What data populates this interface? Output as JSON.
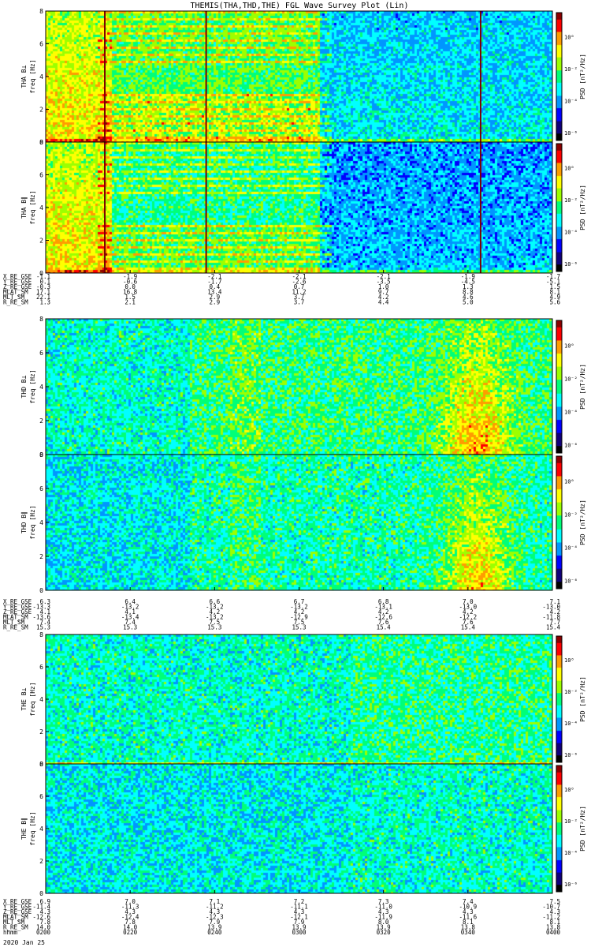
{
  "title": "THEMIS(THA,THD,THE) FGL Wave Survey Plot (Lin)",
  "date_label": "2020 Jan 25",
  "colorbar_label": "PSD [nT²/Hz]",
  "colorbar_ticks": [
    "10⁰",
    "10⁻²",
    "10⁻⁴",
    "10⁻⁶"
  ],
  "colormap": [
    "#000000",
    "#10007a",
    "#0000ff",
    "#0096ff",
    "#00ffff",
    "#00ff78",
    "#9cff00",
    "#ffff00",
    "#ff9c00",
    "#ff0000",
    "#8c0000"
  ],
  "chart_data": [
    {
      "type": "heatmap",
      "probe": "THA",
      "x_axis_type": "time",
      "x_tick_times": [
        "0200",
        "0220",
        "0240",
        "0300",
        "0320",
        "0340",
        "0400"
      ],
      "panels": [
        {
          "ylabel": "THA B⊥",
          "yunit": "freq [Hz]",
          "ylim": [
            0,
            8
          ],
          "yticks": [
            "0",
            "2",
            "4",
            "6",
            "8"
          ],
          "clim_log10": [
            -6.5,
            1.5
          ]
        },
        {
          "ylabel": "THA B∥",
          "yunit": "freq [Hz]",
          "ylim": [
            0,
            8
          ],
          "yticks": [
            "0",
            "2",
            "4",
            "6",
            "8"
          ],
          "clim_log10": [
            -6.5,
            1.5
          ]
        }
      ],
      "data_gaps_at": [
        "0214",
        "0238",
        "0343"
      ],
      "orbit_rows": [
        {
          "label": "X_RE_GSE",
          "values": [
            "-1.1",
            "-1.9",
            "-2.1",
            "-2.1",
            "-2.1",
            "-1.9",
            "-1.7"
          ]
        },
        {
          "label": "Y_RE_GSE",
          "values": [
            "0.1",
            "-0.6",
            "-1.7",
            "-2.6",
            "-3.5",
            "-4.5",
            "-5.1"
          ]
        },
        {
          "label": "Z_RE_GSE",
          "values": [
            "-0.3",
            "0.0",
            "0.4",
            "0.7",
            "1.0",
            "1.3",
            "1.5"
          ]
        },
        {
          "label": "MLAT_SM",
          "values": [
            "17.1",
            "16.8",
            "13.4",
            "11.2",
            "9.7",
            "8.8",
            "8.1"
          ]
        },
        {
          "label": "MLT_SM",
          "values": [
            "22.1",
            "1.5",
            "2.9",
            "3.7",
            "4.2",
            "4.6",
            "4.9"
          ]
        },
        {
          "label": "R_RE_SM",
          "values": [
            "1.3",
            "2.1",
            "2.9",
            "3.7",
            "4.4",
            "5.0",
            "5.6"
          ]
        }
      ]
    },
    {
      "type": "heatmap",
      "probe": "THD",
      "x_axis_type": "time",
      "x_tick_times": [
        "0200",
        "0220",
        "0240",
        "0300",
        "0320",
        "0340",
        "0400"
      ],
      "panels": [
        {
          "ylabel": "THD B⊥",
          "yunit": "freq [Hz]",
          "ylim": [
            0,
            8
          ],
          "yticks": [
            "0",
            "2",
            "4",
            "6",
            "8"
          ],
          "clim_log10": [
            -6.5,
            1.5
          ]
        },
        {
          "ylabel": "THD B∥",
          "yunit": "freq [Hz]",
          "ylim": [
            0,
            8
          ],
          "yticks": [
            "0",
            "2",
            "4",
            "6",
            "8"
          ],
          "clim_log10": [
            -6.5,
            1.5
          ]
        }
      ],
      "orbit_rows": [
        {
          "label": "X_RE_GSE",
          "values": [
            "6.3",
            "6.4",
            "6.6",
            "6.7",
            "6.8",
            "7.0",
            "7.1"
          ]
        },
        {
          "label": "Y_RE_GSE",
          "values": [
            "-13.3",
            "-13.2",
            "-13.2",
            "-13.2",
            "-13.1",
            "-13.0",
            "-13.0"
          ]
        },
        {
          "label": "Z_RE_GSE",
          "values": [
            "4.1",
            "4.1",
            "4.2",
            "4.2",
            "4.2",
            "4.2",
            "4.2"
          ]
        },
        {
          "label": "MLAT_SM",
          "values": [
            "-13.6",
            "-13.4",
            "-13.2",
            "-12.9",
            "-12.6",
            "-12.2",
            "-11.8"
          ]
        },
        {
          "label": "MLT_SM",
          "values": [
            "7.4",
            "7.4",
            "7.5",
            "7.5",
            "7.6",
            "7.6",
            "7.7"
          ]
        },
        {
          "label": "R_RE_SM",
          "values": [
            "15.3",
            "15.3",
            "15.3",
            "15.3",
            "15.4",
            "15.4",
            "15.4"
          ]
        }
      ]
    },
    {
      "type": "heatmap",
      "probe": "THE",
      "x_axis_type": "time",
      "x_tick_times": [
        "0200",
        "0220",
        "0240",
        "0300",
        "0320",
        "0340",
        "0400"
      ],
      "panels": [
        {
          "ylabel": "THE B⊥",
          "yunit": "freq [Hz]",
          "ylim": [
            0,
            8
          ],
          "yticks": [
            "0",
            "2",
            "4",
            "6",
            "8"
          ],
          "clim_log10": [
            -6.5,
            1.5
          ]
        },
        {
          "ylabel": "THE B∥",
          "yunit": "freq [Hz]",
          "ylim": [
            0,
            8
          ],
          "yticks": [
            "0",
            "2",
            "4",
            "6",
            "8"
          ],
          "clim_log10": [
            -6.5,
            1.5
          ]
        }
      ],
      "orbit_rows": [
        {
          "label": "X_RE_GSE",
          "values": [
            "6.9",
            "7.0",
            "7.1",
            "7.2",
            "7.3",
            "7.4",
            "7.5"
          ]
        },
        {
          "label": "Y_RE_GSE",
          "values": [
            "-11.4",
            "-11.3",
            "-11.2",
            "-11.1",
            "-11.0",
            "-10.9",
            "-10.7"
          ]
        },
        {
          "label": "Z_RE_GSE",
          "values": [
            "4.3",
            "4.3",
            "4.3",
            "4.3",
            "4.3",
            "4.3",
            "4.3"
          ]
        },
        {
          "label": "MLAT_SM",
          "values": [
            "-12.6",
            "-12.4",
            "-12.3",
            "-12.1",
            "-11.9",
            "-11.6",
            "-11.2"
          ]
        },
        {
          "label": "MLT_SM",
          "values": [
            "7.8",
            "7.8",
            "7.9",
            "7.9",
            "8.0",
            "8.1",
            "8.1"
          ]
        },
        {
          "label": "R_RE_SM",
          "values": [
            "14.0",
            "14.0",
            "13.9",
            "13.9",
            "13.9",
            "13.8",
            "13.8"
          ]
        },
        {
          "label": "hhmm",
          "values": [
            "0200",
            "0220",
            "0240",
            "0300",
            "0320",
            "0340",
            "0400"
          ]
        }
      ]
    }
  ]
}
